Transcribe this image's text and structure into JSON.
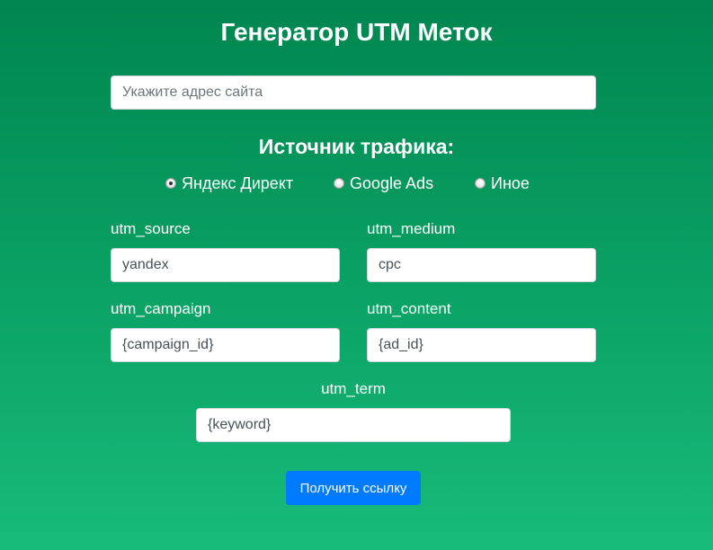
{
  "header": {
    "title": "Генератор UTM Меток"
  },
  "url_field": {
    "placeholder": "Укажите адрес сайта",
    "value": ""
  },
  "traffic_source": {
    "heading": "Источник трафика:",
    "options": [
      {
        "label": "Яндекс Директ",
        "checked": true
      },
      {
        "label": "Google Ads",
        "checked": false
      },
      {
        "label": "Иное",
        "checked": false
      }
    ]
  },
  "fields": {
    "utm_source": {
      "label": "utm_source",
      "value": "yandex"
    },
    "utm_medium": {
      "label": "utm_medium",
      "value": "cpc"
    },
    "utm_campaign": {
      "label": "utm_campaign",
      "value": "{campaign_id}"
    },
    "utm_content": {
      "label": "utm_content",
      "value": "{ad_id}"
    },
    "utm_term": {
      "label": "utm_term",
      "value": "{keyword}"
    }
  },
  "actions": {
    "submit_label": "Получить ссылку"
  },
  "colors": {
    "background_top": "#008650",
    "background_bottom": "#18bb7a",
    "button": "#007bff"
  }
}
